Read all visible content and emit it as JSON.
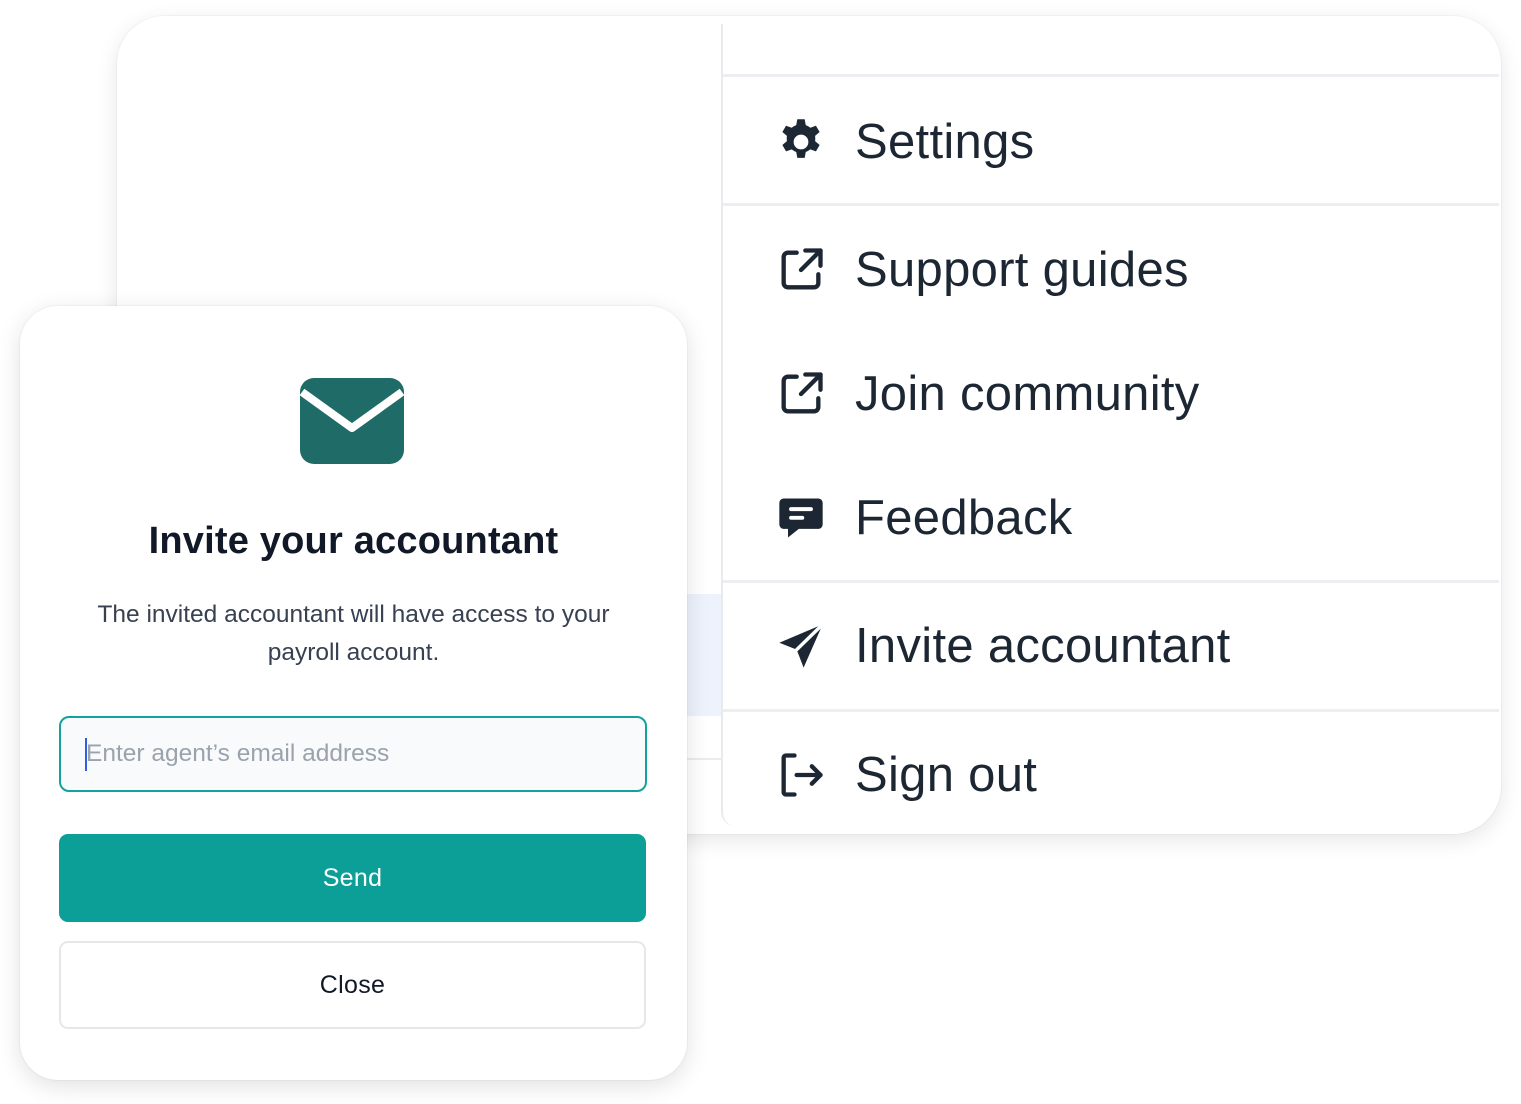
{
  "menu": {
    "items": [
      {
        "label": "Settings",
        "icon": "gear-icon"
      },
      {
        "label": "Support guides",
        "icon": "external-link-icon"
      },
      {
        "label": "Join community",
        "icon": "external-link-icon"
      },
      {
        "label": "Feedback",
        "icon": "chat-bubble-icon"
      },
      {
        "label": "Invite accountant",
        "icon": "paper-plane-icon"
      },
      {
        "label": "Sign out",
        "icon": "sign-out-icon"
      }
    ]
  },
  "modal": {
    "icon": "mail-icon",
    "title": "Invite your accountant",
    "description": "The invited accountant will have access to your payroll account.",
    "email_placeholder": "Enter agent’s email address",
    "email_value": "",
    "send_label": "Send",
    "close_label": "Close"
  },
  "colors": {
    "accent": "#0c9f98",
    "icon_dark": "#1f6b67",
    "text_dark": "#1d2733"
  }
}
